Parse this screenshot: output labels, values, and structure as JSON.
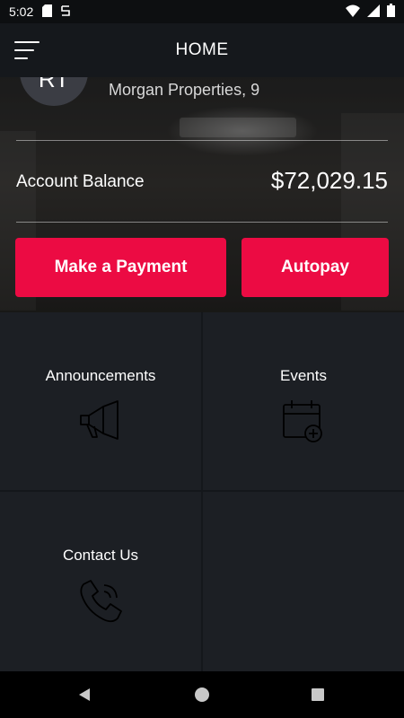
{
  "status_bar": {
    "time": "5:02"
  },
  "header": {
    "title": "HOME"
  },
  "account": {
    "avatar_initials": "RT",
    "property_name": "Morgan Properties, 9",
    "balance_label": "Account Balance",
    "balance_value": "$72,029.15"
  },
  "actions": {
    "payment_label": "Make a Payment",
    "autopay_label": "Autopay"
  },
  "tiles": [
    {
      "label": "Announcements",
      "icon": "megaphone-icon"
    },
    {
      "label": "Events",
      "icon": "calendar-add-icon"
    },
    {
      "label": "Contact Us",
      "icon": "phone-ringing-icon"
    }
  ],
  "colors": {
    "accent": "#ec0b43",
    "tile_bg": "#1c1f24",
    "header_bg": "#15181c"
  }
}
